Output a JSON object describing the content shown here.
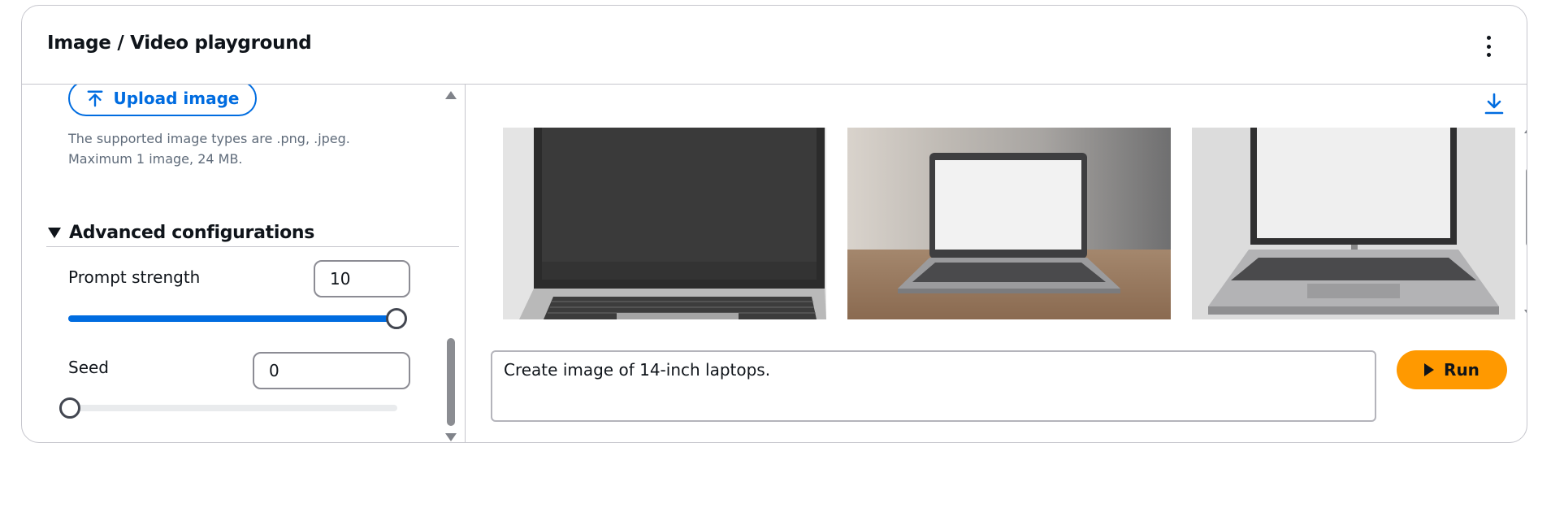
{
  "header": {
    "title": "Image / Video playground",
    "menu_icon": "more-vertical-icon"
  },
  "left_panel": {
    "upload_button": {
      "label": "Upload image",
      "icon": "upload-icon"
    },
    "upload_hint_line1": "The supported image types are .png, .jpeg.",
    "upload_hint_line2": "Maximum 1 image, 24 MB.",
    "advanced": {
      "label": "Advanced configurations",
      "expanded": true
    },
    "prompt_strength": {
      "label": "Prompt strength",
      "value": "10",
      "slider_fraction": 1.0
    },
    "seed": {
      "label": "Seed",
      "value": "0",
      "slider_fraction": 0.0
    }
  },
  "right_panel": {
    "download_icon": "download-icon",
    "images": [
      {
        "name": "generated-image-1",
        "description": "closeup laptop dark screen"
      },
      {
        "name": "generated-image-2",
        "description": "laptop on wooden desk"
      },
      {
        "name": "generated-image-3",
        "description": "laptop white screen on grey"
      }
    ],
    "prompt": {
      "value": "Create image of 14-inch laptops."
    },
    "run_button": {
      "label": "Run",
      "icon": "play-icon"
    }
  },
  "colors": {
    "accent": "#006ce0",
    "run": "#ff9900",
    "border": "#c6c6cd"
  }
}
